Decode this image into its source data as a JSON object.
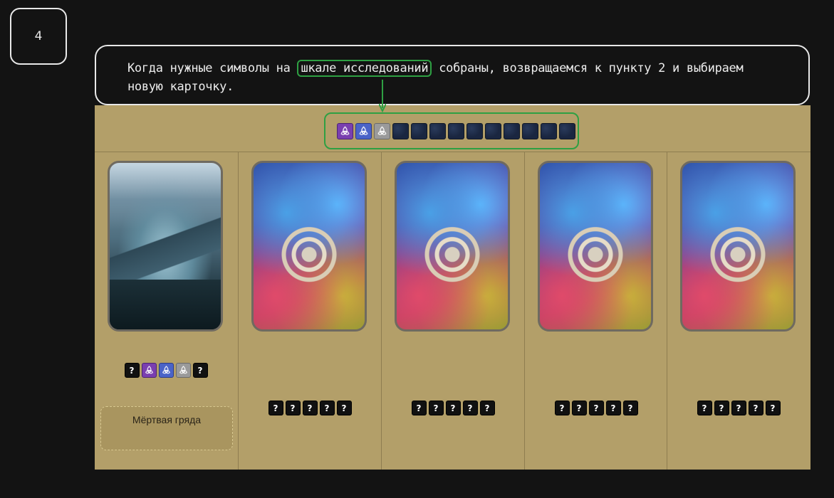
{
  "step": {
    "number": "4"
  },
  "callout": {
    "text_before": "Когда нужные символы на ",
    "highlight": "шкале исследований",
    "text_after": " собраны, возвращаемся к пункту 2 и выбираем новую карточку."
  },
  "track": {
    "slots": [
      "purple",
      "blue",
      "gray",
      "empty",
      "empty",
      "empty",
      "empty",
      "empty",
      "empty",
      "empty",
      "empty",
      "empty",
      "empty"
    ]
  },
  "colors": {
    "accent_green": "#2ea043",
    "board": "#b39f69",
    "purple": "#7a3fb0",
    "blue": "#4a63c8",
    "gray": "#9a9a9a"
  },
  "columns": [
    {
      "card": "landscape",
      "icons": [
        "?",
        "purple",
        "blue",
        "gray",
        "?"
      ],
      "location_name": "Мёртвая гряда"
    },
    {
      "card": "back",
      "icons": [
        "?",
        "?",
        "?",
        "?",
        "?"
      ]
    },
    {
      "card": "back",
      "icons": [
        "?",
        "?",
        "?",
        "?",
        "?"
      ]
    },
    {
      "card": "back",
      "icons": [
        "?",
        "?",
        "?",
        "?",
        "?"
      ]
    },
    {
      "card": "back",
      "icons": [
        "?",
        "?",
        "?",
        "?",
        "?"
      ]
    }
  ],
  "unknown_label": "?"
}
